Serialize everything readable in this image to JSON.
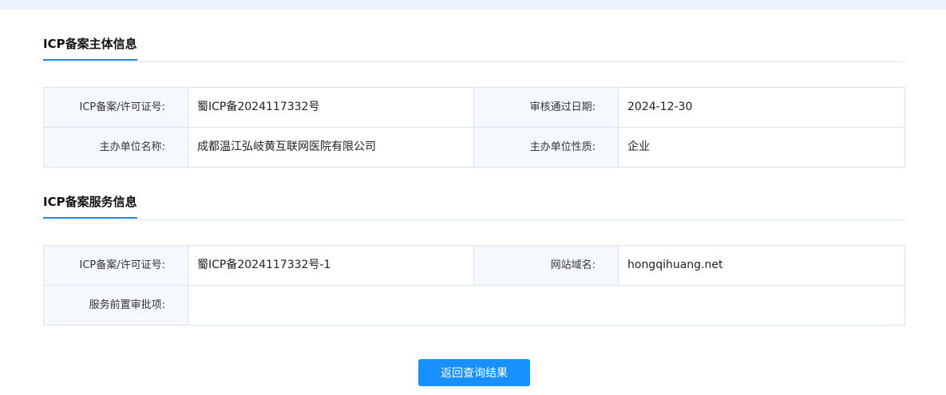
{
  "subject_section": {
    "title": "ICP备案主体信息",
    "rows": [
      [
        {
          "label": "ICP备案/许可证号:",
          "value": "蜀ICP备2024117332号"
        },
        {
          "label": "审核通过日期:",
          "value": "2024-12-30"
        }
      ],
      [
        {
          "label": "主办单位名称:",
          "value": "成都温江弘岐黄互联网医院有限公司"
        },
        {
          "label": "主办单位性质:",
          "value": "企业"
        }
      ]
    ]
  },
  "service_section": {
    "title": "ICP备案服务信息",
    "rows": [
      [
        {
          "label": "ICP备案/许可证号:",
          "value": "蜀ICP备2024117332号-1"
        },
        {
          "label": "网站域名:",
          "value": "hongqihuang.net"
        }
      ],
      [
        {
          "label": "服务前置审批项:",
          "value": ""
        }
      ]
    ]
  },
  "actions": {
    "back_label": "返回查询结果"
  }
}
